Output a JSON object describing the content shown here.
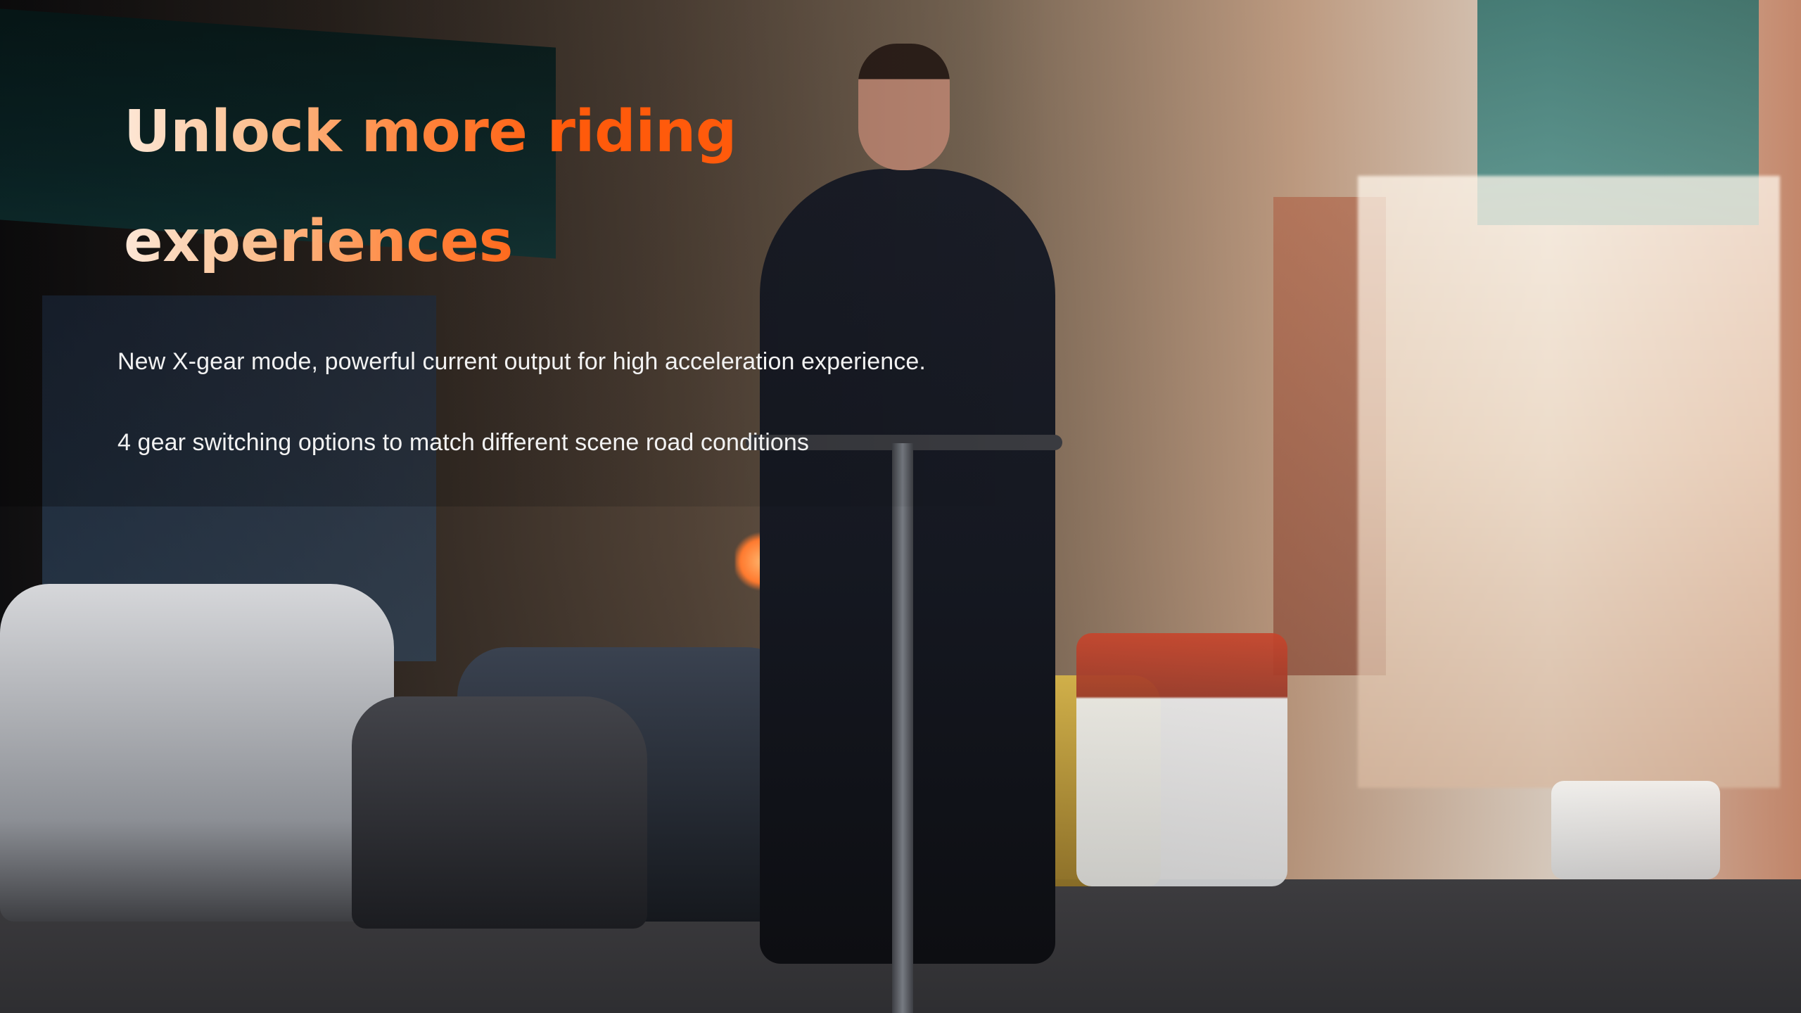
{
  "hero": {
    "headline_line1": "Unlock more riding",
    "headline_line2": "experiences",
    "feature_1": "New X-gear mode, powerful current output for high acceleration experience.",
    "feature_2": "4 gear switching options to match different scene road conditions"
  },
  "colors": {
    "headline_gradient_start": "#fde7d6",
    "headline_gradient_end": "#ff5a0b",
    "body_text": "#f2f2f2"
  },
  "photo": {
    "subject": "man in dark suit riding an electric scooter on a city street",
    "scene": "urban street with parked cars and sunlit buildings"
  }
}
